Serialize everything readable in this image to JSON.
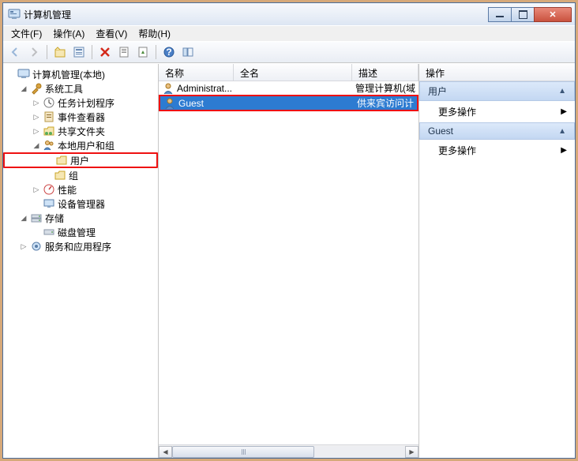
{
  "window": {
    "title": "计算机管理"
  },
  "menu": {
    "file": "文件(F)",
    "action": "操作(A)",
    "view": "查看(V)",
    "help": "帮助(H)"
  },
  "tree": {
    "root": "计算机管理(本地)",
    "system_tools": "系统工具",
    "task_scheduler": "任务计划程序",
    "event_viewer": "事件查看器",
    "shared_folders": "共享文件夹",
    "local_users_groups": "本地用户和组",
    "users": "用户",
    "groups": "组",
    "performance": "性能",
    "device_manager": "设备管理器",
    "storage": "存储",
    "disk_management": "磁盘管理",
    "services_apps": "服务和应用程序"
  },
  "list": {
    "columns": {
      "name": "名称",
      "fullname": "全名",
      "desc": "描述"
    },
    "rows": [
      {
        "name": "Administrat...",
        "fullname": "",
        "desc": "管理计算机(域"
      },
      {
        "name": "Guest",
        "fullname": "",
        "desc": "供来宾访问计"
      }
    ]
  },
  "actions": {
    "title": "操作",
    "group1": "用户",
    "more": "更多操作",
    "group2": "Guest"
  }
}
